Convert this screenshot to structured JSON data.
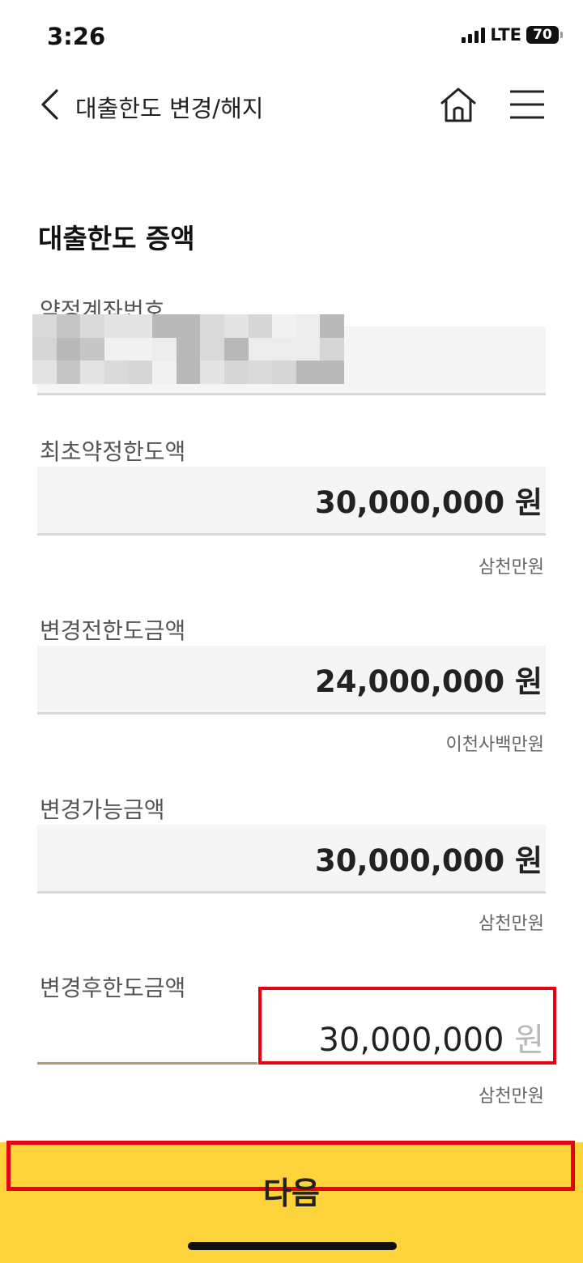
{
  "status_bar": {
    "time": "3:26",
    "network": "LTE",
    "battery": "70"
  },
  "header": {
    "title": "대출한도 변경/해지"
  },
  "section": {
    "title": "대출한도 증액"
  },
  "fields": {
    "account": {
      "label": "약정계좌번호"
    },
    "initial_limit": {
      "label": "최초약정한도액",
      "value": "30,000,000 원",
      "in_words": "삼천만원"
    },
    "limit_before": {
      "label": "변경전한도금액",
      "value": "24,000,000 원",
      "in_words": "이천사백만원"
    },
    "changeable": {
      "label": "변경가능금액",
      "value": "30,000,000 원",
      "in_words": "삼천만원"
    },
    "limit_after": {
      "label": "변경후한도금액",
      "value": "30,000,000",
      "unit": "원",
      "in_words": "삼천만원"
    }
  },
  "footer": {
    "next_label": "다음"
  },
  "colors": {
    "accent_yellow": "#fcd33a",
    "highlight_red": "#e60012",
    "focus_line": "#b39a73"
  },
  "icons": [
    "back-chevron-icon",
    "home-icon",
    "hamburger-menu-icon"
  ]
}
